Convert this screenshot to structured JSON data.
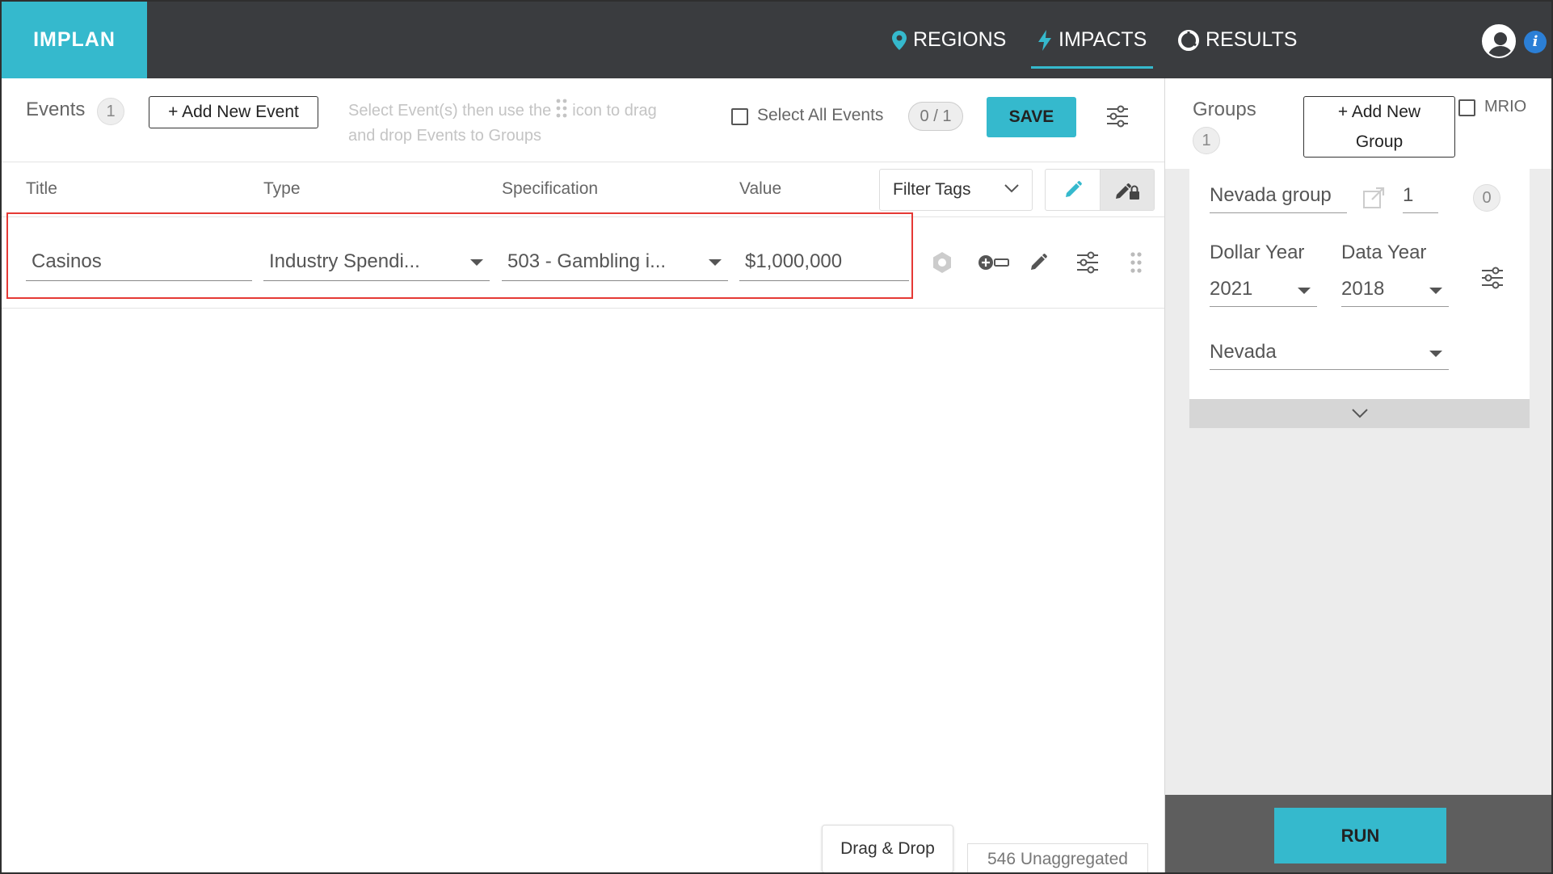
{
  "app": {
    "logo": "IMPLAN"
  },
  "nav": {
    "regions": "REGIONS",
    "impacts": "IMPACTS",
    "results": "RESULTS"
  },
  "events": {
    "label": "Events",
    "count": "1",
    "add_button": "+ Add New Event",
    "hint_part1": "Select Event(s) then use the",
    "hint_part2": "icon to drag and drop Events to Groups",
    "select_all_label": "Select All Events",
    "selected_counter": "0 / 1",
    "save_label": "SAVE"
  },
  "columns": {
    "title": "Title",
    "type": "Type",
    "specification": "Specification",
    "value": "Value",
    "filter_tags": "Filter Tags"
  },
  "event_row": {
    "title": "Casinos",
    "type": "Industry Spendi...",
    "specification": "503 - Gambling i...",
    "value": "$1,000,000"
  },
  "bottom": {
    "drag_drop": "Drag & Drop",
    "unaggregated": "546 Unaggregated"
  },
  "groups": {
    "label": "Groups",
    "count": "1",
    "add_button": "+ Add New Group",
    "mrio_label": "MRIO",
    "group": {
      "name": "Nevada group",
      "multiplier": "1",
      "event_count": "0",
      "dollar_year_label": "Dollar Year",
      "dollar_year": "2021",
      "data_year_label": "Data Year",
      "data_year": "2018",
      "region": "Nevada"
    },
    "run_label": "RUN"
  },
  "colors": {
    "accent": "#35b9cd",
    "header_bg": "#3a3c3f",
    "highlight": "#e53935",
    "info": "#2b7fd6"
  }
}
